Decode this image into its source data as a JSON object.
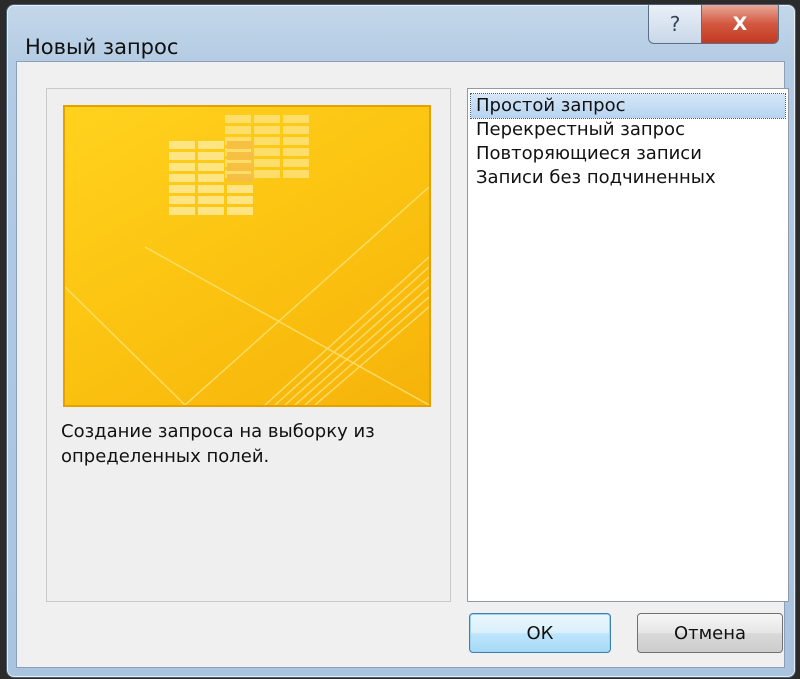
{
  "window": {
    "title": "Новый запрос",
    "help_glyph": "?",
    "close_glyph": "X",
    "icons": {
      "help": "help-icon",
      "close": "close-icon"
    }
  },
  "preview": {
    "icon": "query-wizard-illustration",
    "background_color": "#fcc512",
    "border_color": "#e6a100",
    "description": "Создание запроса на выборку из определенных полей."
  },
  "list": {
    "items": [
      {
        "label": "Простой запрос",
        "selected": true
      },
      {
        "label": "Перекрестный запрос",
        "selected": false
      },
      {
        "label": "Повторяющиеся записи",
        "selected": false
      },
      {
        "label": "Записи без подчиненных",
        "selected": false
      }
    ]
  },
  "buttons": {
    "ok": "ОК",
    "cancel": "Отмена"
  },
  "colors": {
    "selection": "#c3dcf4",
    "ok_accent": "#3c7fb1",
    "close_button": "#c23a22"
  }
}
